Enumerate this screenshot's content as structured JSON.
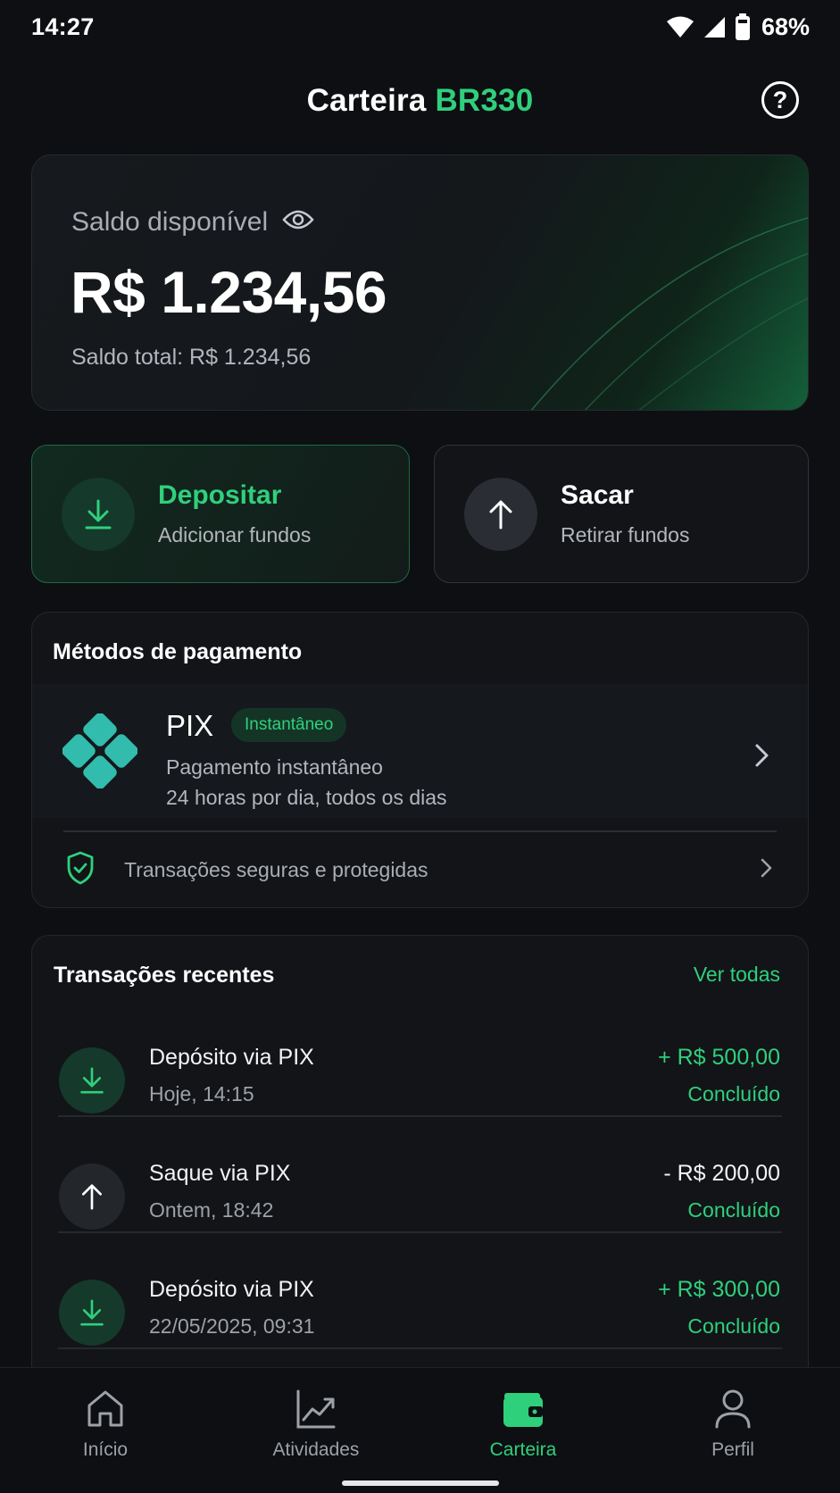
{
  "status_bar": {
    "time": "14:27",
    "battery_percent": "68%",
    "icons": [
      "wifi-icon",
      "signal-icon",
      "battery-icon"
    ]
  },
  "header": {
    "title_prefix": "Carteira",
    "title_accent": "BR330",
    "help_icon": "help-circle-icon",
    "help_label": "?"
  },
  "balance": {
    "label": "Saldo disponível",
    "visibility_icon": "eye-icon",
    "value": "R$ 1.234,56",
    "total": "Saldo total: R$ 1.234,56"
  },
  "actions": {
    "deposit": {
      "title": "Depositar",
      "subtitle": "Adicionar fundos",
      "icon": "download-arrow-icon"
    },
    "withdraw": {
      "title": "Sacar",
      "subtitle": "Retirar fundos",
      "icon": "upload-arrow-icon"
    }
  },
  "payment_methods": {
    "title": "Métodos de pagamento",
    "pix": {
      "name": "PIX",
      "badge": "Instantâneo",
      "description": "Pagamento instantâneo",
      "availability": "24 horas por dia, todos os dias",
      "icon": "pix-logo-icon"
    },
    "security": {
      "text": "Transações seguras e protegidas",
      "icon": "shield-check-icon"
    }
  },
  "transactions": {
    "title": "Transações recentes",
    "see_all": "Ver todas",
    "items": [
      {
        "name": "Depósito via PIX",
        "date": "Hoje, 14:15",
        "amount": "+ R$ 500,00",
        "status": "Concluído",
        "direction": "in"
      },
      {
        "name": "Saque via PIX",
        "date": "Ontem, 18:42",
        "amount": "- R$ 200,00",
        "status": "Concluído",
        "direction": "out"
      },
      {
        "name": "Depósito via PIX",
        "date": "22/05/2025, 09:31",
        "amount": "+ R$ 300,00",
        "status": "Concluído",
        "direction": "in"
      }
    ]
  },
  "bottom_nav": {
    "items": [
      {
        "label": "Início",
        "icon": "home-icon",
        "active": false
      },
      {
        "label": "Atividades",
        "icon": "chart-icon",
        "active": false
      },
      {
        "label": "Carteira",
        "icon": "wallet-icon",
        "active": true
      },
      {
        "label": "Perfil",
        "icon": "user-icon",
        "active": false
      }
    ]
  },
  "colors": {
    "accent": "#2fd07c",
    "background": "#0d0f12",
    "card": "#121418"
  }
}
